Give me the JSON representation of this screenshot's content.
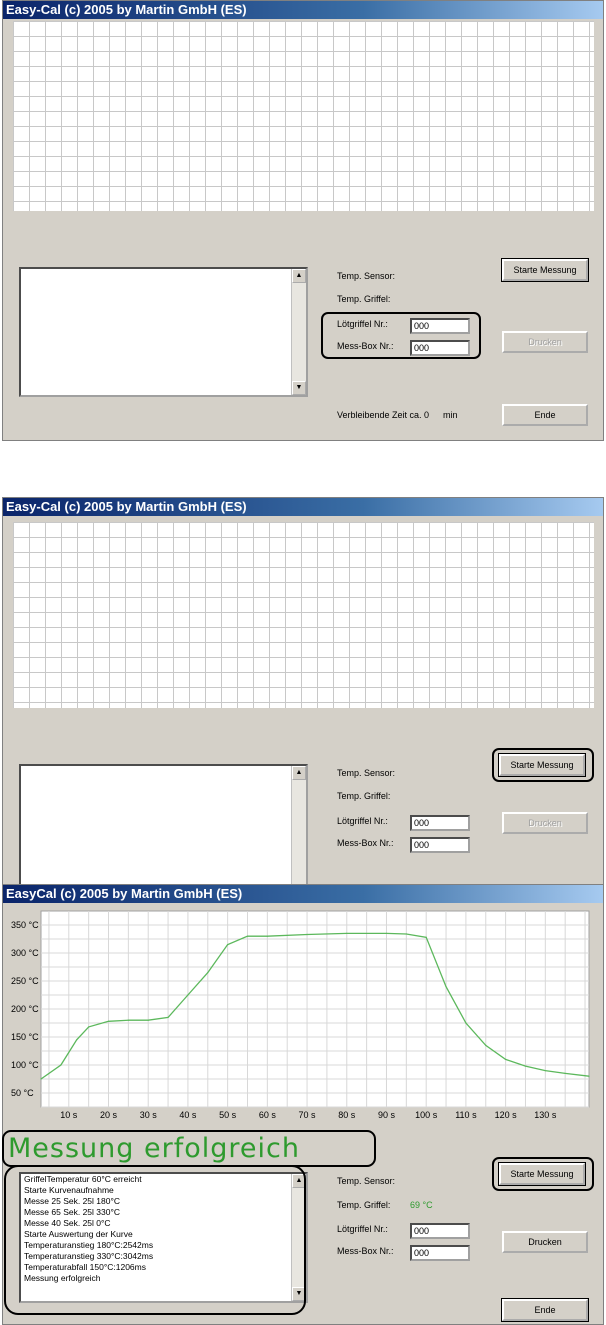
{
  "panels": [
    {
      "title": "Easy-Cal (c) 2005 by Martin GmbH (ES)",
      "temp_sensor_label": "Temp. Sensor:",
      "temp_griffel_label": "Temp. Griffel:",
      "loetgriffel_label": "Lötgriffel Nr.:",
      "loetgriffel_value": "000",
      "messbox_label": "Mess-Box Nr.:",
      "messbox_value": "000",
      "start_button": "Starte Messung",
      "print_button": "Drucken",
      "end_button": "Ende",
      "remaining_time": "Verbleibende Zeit ca. 0",
      "remaining_unit": "min"
    },
    {
      "title": "Easy-Cal (c) 2005 by Martin GmbH (ES)",
      "temp_sensor_label": "Temp. Sensor:",
      "temp_griffel_label": "Temp. Griffel:",
      "loetgriffel_label": "Lötgriffel Nr.:",
      "loetgriffel_value": "000",
      "messbox_label": "Mess-Box Nr.:",
      "messbox_value": "000",
      "start_button": "Starte Messung",
      "print_button": "Drucken"
    },
    {
      "title": "EasyCal (c) 2005 by Martin GmbH (ES)",
      "status_banner": "Messung erfolgreich",
      "temp_sensor_label": "Temp. Sensor:",
      "temp_griffel_label": "Temp. Griffel:",
      "temp_griffel_value": "69 °C",
      "loetgriffel_label": "Lötgriffel Nr.:",
      "loetgriffel_value": "000",
      "messbox_label": "Mess-Box Nr.:",
      "messbox_value": "000",
      "start_button": "Starte Messung",
      "print_button": "Drucken",
      "end_button": "Ende",
      "log": [
        "GriffelTemperatur 60°C erreicht",
        "Starte Kurvenaufnahme",
        "Messe 25 Sek. 25l 180°C",
        "Messe 65 Sek. 25l 330°C",
        "Messe 40 Sek. 25l 0°C",
        "Starte Auswertung der Kurve",
        "Temperaturanstieg 180°C:2542ms",
        "Temperaturanstieg 330°C:3042ms",
        "Temperaturabfall 150°C:1206ms",
        "Messung erfolgreich"
      ]
    }
  ],
  "scroll_icons": {
    "up": "▲",
    "down": "▼"
  },
  "colors": {
    "curve": "#5cb85c",
    "griffel_temp": "#2e9a2e",
    "titlebar": "#0a246a"
  },
  "chart_data": {
    "type": "line",
    "title": "",
    "xlabel": "",
    "ylabel": "",
    "x_ticks": [
      "10 s",
      "20 s",
      "30 s",
      "40 s",
      "50 s",
      "60 s",
      "70 s",
      "80 s",
      "90 s",
      "100 s",
      "110 s",
      "120 s",
      "130 s"
    ],
    "y_ticks": [
      "50 °C",
      "100 °C",
      "150 °C",
      "200 °C",
      "250 °C",
      "300 °C",
      "350 °C"
    ],
    "xlim": [
      3,
      141
    ],
    "ylim": [
      25,
      375
    ],
    "grid": true,
    "series": [
      {
        "x": [
          3,
          8,
          12,
          15,
          20,
          25,
          30,
          35,
          40,
          45,
          50,
          55,
          60,
          70,
          80,
          90,
          95,
          100,
          105,
          110,
          115,
          120,
          125,
          130,
          135,
          141
        ],
        "y": [
          75,
          100,
          145,
          168,
          178,
          180,
          180,
          185,
          225,
          265,
          315,
          330,
          330,
          333,
          335,
          335,
          334,
          328,
          240,
          175,
          135,
          110,
          98,
          90,
          85,
          80
        ]
      }
    ]
  }
}
